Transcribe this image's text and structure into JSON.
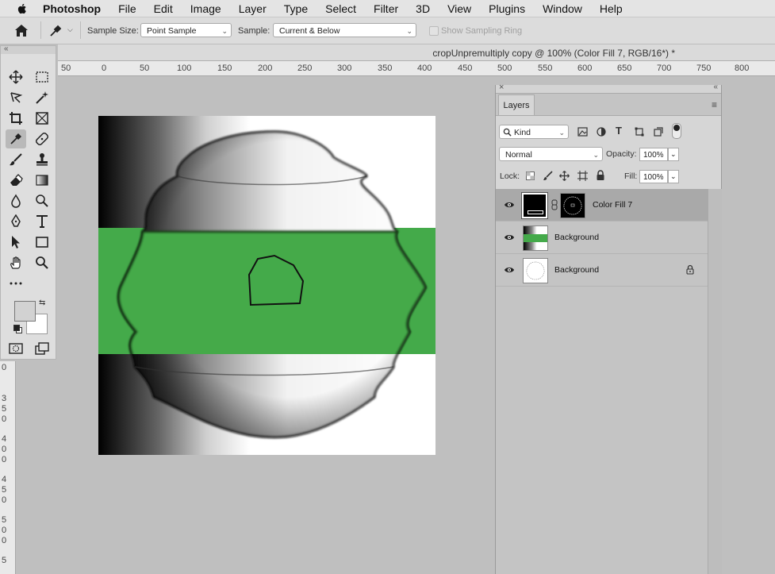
{
  "menubar": {
    "app": "Photoshop",
    "items": [
      "File",
      "Edit",
      "Image",
      "Layer",
      "Type",
      "Select",
      "Filter",
      "3D",
      "View",
      "Plugins",
      "Window",
      "Help"
    ]
  },
  "options": {
    "sample_size_label": "Sample Size:",
    "sample_size_value": "Point Sample",
    "sample_label": "Sample:",
    "sample_value": "Current & Below",
    "sampling_ring": "Show Sampling Ring"
  },
  "document": {
    "title": "cropUnpremultiply copy @ 100% (Color Fill 7, RGB/16*) *"
  },
  "ruler": {
    "h_ticks": [
      "50",
      "0",
      "50",
      "100",
      "150",
      "200",
      "250",
      "300",
      "350",
      "400",
      "450",
      "500",
      "550",
      "600",
      "650",
      "700",
      "750",
      "800"
    ],
    "v_ticks": [
      "0",
      "3",
      "5",
      "0",
      "4",
      "0",
      "0",
      "4",
      "5",
      "0",
      "5",
      "0",
      "0",
      "5"
    ]
  },
  "layers": {
    "tab": "Layers",
    "filter_kind": "Kind",
    "blend_mode": "Normal",
    "opacity_label": "Opacity:",
    "opacity_value": "100%",
    "lock_label": "Lock:",
    "fill_label": "Fill:",
    "fill_value": "100%",
    "items": [
      {
        "name": "Color Fill 7"
      },
      {
        "name": "Background"
      },
      {
        "name": "Background"
      }
    ]
  },
  "colors": {
    "green_band": "#44aa4a",
    "selected_row": "#a8a8a8"
  }
}
